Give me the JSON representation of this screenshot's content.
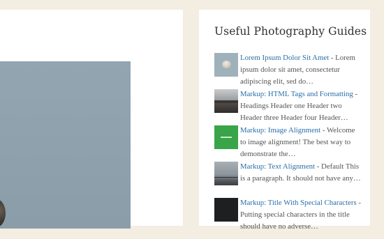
{
  "sidebar": {
    "title": "Useful Photography Guides",
    "posts": [
      {
        "title": "Lorem Ipsum Dolor Sit Amet",
        "separator": " - ",
        "excerpt": "Lorem ipsum dolor sit amet, consectetur adipiscing elit, sed do…",
        "thumb_icon": "stone-photo-thumbnail"
      },
      {
        "title": "Markup: HTML Tags and Formatting",
        "separator": " - ",
        "excerpt": "Headings Header one Header two Header three Header four Header…",
        "thumb_icon": "pier-photo-thumbnail"
      },
      {
        "title": "Markup: Image Alignment",
        "separator": " - ",
        "excerpt": "Welcome to image alignment! The best way to demonstrate the…",
        "thumb_icon": "green-image-thumbnail"
      },
      {
        "title": "Markup: Text Alignment",
        "separator": " - ",
        "excerpt": "Default This is a paragraph. It should not have any…",
        "thumb_icon": "fog-photo-thumbnail"
      },
      {
        "title": "Markup: Title With Special Characters",
        "separator": " - ",
        "excerpt": "Putting special characters in the title should have no adverse…",
        "thumb_icon": "dark-text-thumbnail"
      }
    ]
  },
  "colors": {
    "background": "#f3ede2",
    "link": "#2a6fa8",
    "text": "#555555",
    "heading": "#2f2f2f"
  }
}
